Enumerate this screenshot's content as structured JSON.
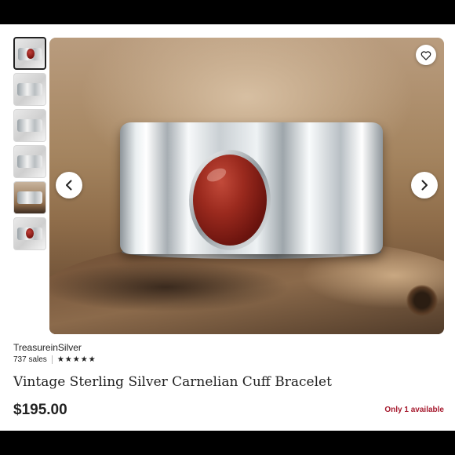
{
  "listing": {
    "shop_name": "TreasureinSilver",
    "sales_count": "737 sales",
    "rating_stars": 5,
    "title": "Vintage Sterling Silver Carnelian Cuff Bracelet",
    "price": "$195.00",
    "availability": "Only 1 available"
  },
  "gallery": {
    "thumbnail_count": 6,
    "active_index": 0
  },
  "icons": {
    "favorite": "heart-icon",
    "previous": "chevron-left-icon",
    "next": "chevron-right-icon",
    "rating": "star-icon"
  },
  "colors": {
    "text": "#222222",
    "availability": "#a61a2e",
    "frame": "#000000"
  }
}
